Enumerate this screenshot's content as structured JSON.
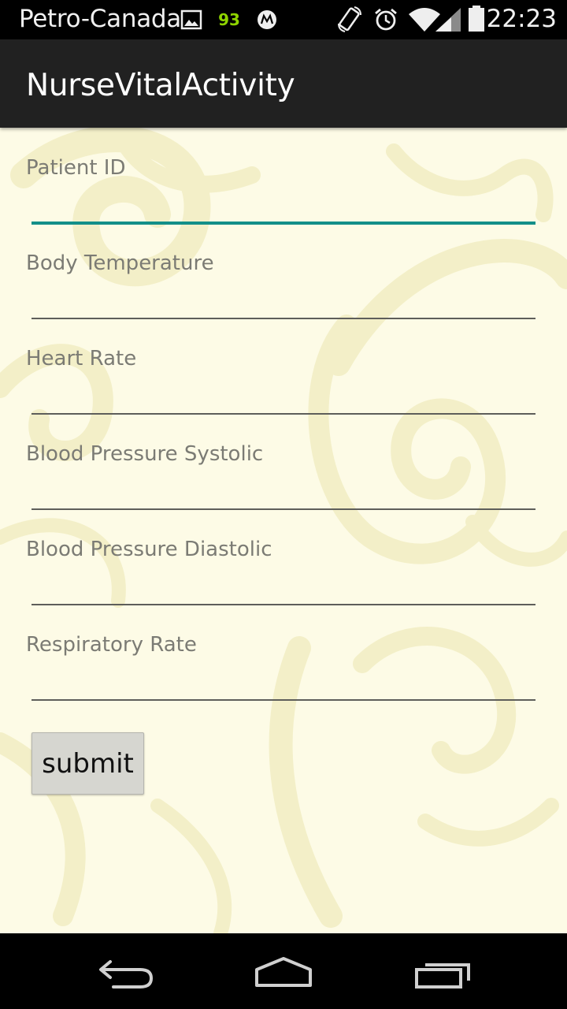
{
  "status_bar": {
    "carrier": "Petro-Canada",
    "badge": "93",
    "time": "22:23",
    "icons": [
      "image-icon",
      "motorola-icon",
      "rotate-icon",
      "alarm-icon",
      "wifi-icon",
      "signal-icon",
      "battery-icon"
    ]
  },
  "action_bar": {
    "title": "NurseVitalActivity"
  },
  "form": {
    "fields": [
      {
        "label": "Patient ID",
        "value": "",
        "focused": true
      },
      {
        "label": "Body Temperature",
        "value": ""
      },
      {
        "label": "Heart Rate",
        "value": ""
      },
      {
        "label": "Blood Pressure Systolic",
        "value": ""
      },
      {
        "label": "Blood Pressure Diastolic",
        "value": ""
      },
      {
        "label": "Respiratory Rate",
        "value": ""
      }
    ],
    "submit_label": "submit"
  },
  "nav_bar": {
    "icons": [
      "back-icon",
      "home-icon",
      "recents-icon"
    ]
  },
  "colors": {
    "focus_accent": "#138f89",
    "content_background": "#fdfbe6",
    "pattern": "#efe9b8"
  }
}
